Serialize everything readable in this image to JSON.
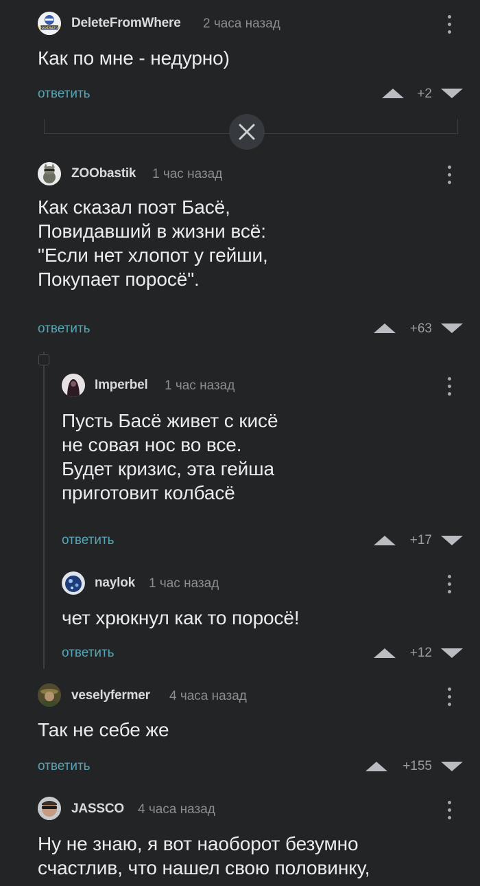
{
  "reply_label": "ответить",
  "collapse_icon": "close-icon",
  "comments": [
    {
      "user": "DeleteFromWhere",
      "time": "2 часа назад",
      "text": "Как по мне - недурно)",
      "score": "+2",
      "avatar_label": "MODERATOR"
    },
    {
      "user": "ZOObastik",
      "time": "1 час назад",
      "text": "Как сказал поэт Басё,\nПовидавший в жизни всё:\n\"Если нет хлопот у гейши,\nПокупает поросё\".",
      "score": "+63"
    },
    {
      "user": "Imperbel",
      "time": "1 час назад",
      "text": "Пусть Басё живет с кисё\nне совая нос во все.\nБудет кризис, эта гейша\nприготовит колбасё",
      "score": "+17"
    },
    {
      "user": "naylok",
      "time": "1 час назад",
      "text": "чет хрюкнул как то поросё!",
      "score": "+12"
    },
    {
      "user": "veselyfermer",
      "time": "4 часа назад",
      "text": "Так не себе же",
      "score": "+155"
    },
    {
      "user": "JASSCO",
      "time": "4 часа назад",
      "text": "Ну не знаю, я вот наоборот безумно\nсчастлив, что нашел свою половинку,",
      "score": ""
    }
  ]
}
